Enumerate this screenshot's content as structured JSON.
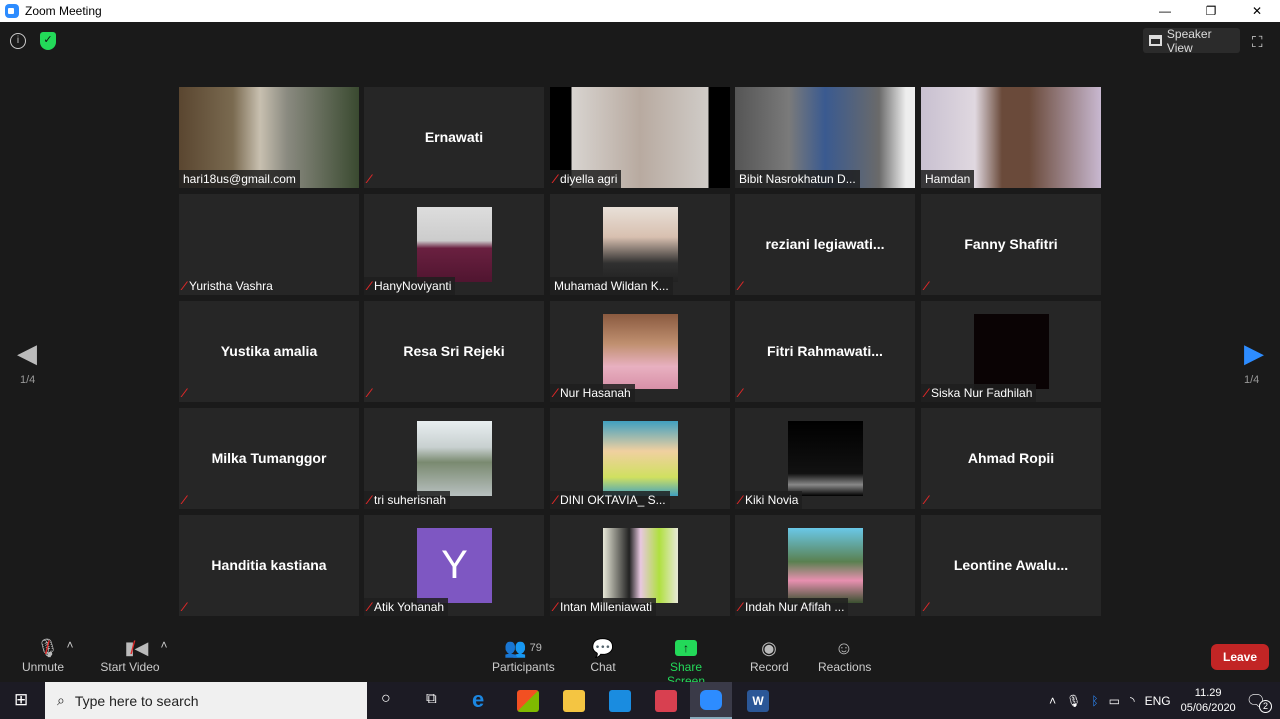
{
  "window": {
    "title": "Zoom Meeting",
    "minimize": "—",
    "restore": "❐",
    "close": "✕"
  },
  "topbar": {
    "info_icon": "i",
    "shield_icon": "✓",
    "speaker_view": "Speaker View",
    "fullscreen_icon": "⛶"
  },
  "pager": {
    "prev_page": "1/4",
    "next_page": "1/4"
  },
  "colors": {
    "active_speaker": "#d7e36a",
    "share_screen": "#23d959",
    "leave": "#c22525",
    "accent": "#2d8cff"
  },
  "tiles": [
    {
      "name": "hari18us@gmail.com",
      "type": "video",
      "muted": false,
      "bg": "linear-gradient(90deg,#5a4630 0,#7a6a50 30%,#c8c0b0 45%,#8a8a80 60%,#3a4a30 100%)"
    },
    {
      "name": "Ernawati",
      "type": "name",
      "muted": true
    },
    {
      "name": "diyella agri",
      "type": "video",
      "muted": true,
      "bg": "linear-gradient(90deg,#000 0,#000 12%,#d8d4d0 12%,#b8aaa0 50%,#d0ccc8 88%,#000 88%)"
    },
    {
      "name": "Bibit Nasrokhatun D...",
      "type": "video",
      "muted": false,
      "active": true,
      "bg": "linear-gradient(90deg,#555 0,#7a7a7a 30%,#3a5a90 50%,#6a6a6a 80%,#eee 95%)"
    },
    {
      "name": "Hamdan",
      "type": "video",
      "muted": false,
      "bg": "linear-gradient(90deg,#c8c0d0 0,#e0d8e0 30%,#6a4a3a 45%,#6a4a3a 60%,#c8b8d0 100%)"
    },
    {
      "name": "Yuristha Vashra",
      "type": "name",
      "display": "",
      "muted": true
    },
    {
      "name": "HanyNoviyanti",
      "type": "photo",
      "muted": true,
      "bg": "linear-gradient(180deg,#ddd 0,#ccc 45%,#6a2040 55%,#501530 100%)"
    },
    {
      "name": "Muhamad Wildan K...",
      "type": "photo",
      "muted": false,
      "bg": "linear-gradient(180deg,#e8e0d8 0,#d8c0b0 40%,#303030 75%,#222 100%)"
    },
    {
      "name": "reziani  legiawati...",
      "type": "name",
      "muted": true
    },
    {
      "name": "Fanny Shafitri",
      "type": "name",
      "muted": true
    },
    {
      "name": "Yustika amalia",
      "type": "name",
      "muted": true
    },
    {
      "name": "Resa Sri Rejeki",
      "type": "name",
      "muted": true
    },
    {
      "name": "Nur Hasanah",
      "type": "photo",
      "muted": true,
      "bg": "linear-gradient(180deg,#8a5a40 0,#c09070 40%,#e8b0c0 70%,#d890a8 100%)"
    },
    {
      "name": "Fitri  Rahmawati...",
      "type": "name",
      "muted": true
    },
    {
      "name": "Siska Nur Fadhilah",
      "type": "photo",
      "muted": true,
      "bg": "#0a0304"
    },
    {
      "name": "Milka Tumanggor",
      "type": "name",
      "muted": true
    },
    {
      "name": "tri suherisnah",
      "type": "photo",
      "muted": true,
      "bg": "linear-gradient(180deg,#e8eef0 0,#c8d0d0 35%,#7a8a70 55%,#b8c0c0 100%)"
    },
    {
      "name": "DINI OKTAVIA_ S...",
      "type": "photo",
      "muted": true,
      "bg": "linear-gradient(180deg,#40a0c0 0,#f0d0a0 40%,#d0e060 75%,#40a0c0 100%)"
    },
    {
      "name": "Kiki Novia",
      "type": "photo",
      "muted": true,
      "bg": "linear-gradient(180deg,#000 0,#111 70%,#888 85%,#000 100%)"
    },
    {
      "name": "Ahmad Ropii",
      "type": "name",
      "muted": true
    },
    {
      "name": "Handitia kastiana",
      "type": "name",
      "muted": true
    },
    {
      "name": "Atik Yohanah",
      "type": "letter",
      "letter": "Y",
      "muted": true,
      "bg": "#7e57c2"
    },
    {
      "name": "Intan Milleniawati",
      "type": "photo",
      "muted": true,
      "bg": "linear-gradient(90deg,#e8e8d8 0,#222 35%,#e8c8e0 50%,#b0e040 75%,#e8e8d8 100%)"
    },
    {
      "name": "Indah Nur Afifah ...",
      "type": "photo",
      "muted": true,
      "bg": "linear-gradient(180deg,#6ac8e8 0,#5a8050 45%,#e890b0 70%,#3a5030 100%)"
    },
    {
      "name": "Leontine  Awalu...",
      "type": "name",
      "muted": true
    }
  ],
  "toolbar": {
    "unmute": "Unmute",
    "start_video": "Start Video",
    "participants": "Participants",
    "participants_count": "79",
    "chat": "Chat",
    "share_screen": "Share Screen",
    "record": "Record",
    "reactions": "Reactions",
    "leave": "Leave"
  },
  "taskbar": {
    "search_placeholder": "Type here to search",
    "language": "ENG",
    "time": "11.29",
    "date": "05/06/2020",
    "notifications": "2"
  }
}
